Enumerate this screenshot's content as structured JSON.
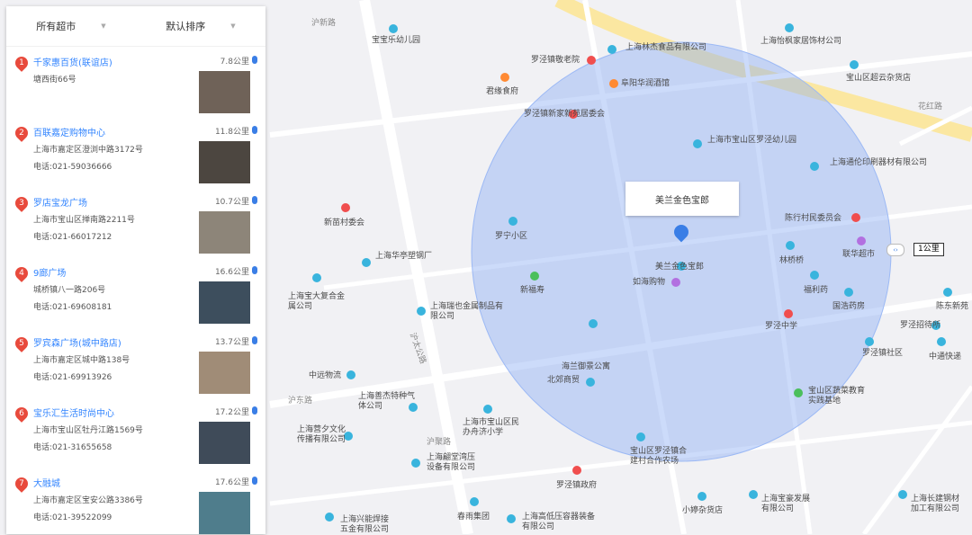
{
  "filters": {
    "category": "所有超市",
    "sort": "默认排序"
  },
  "stores": [
    {
      "num": "1",
      "name": "千家惠百货(联谊店)",
      "address": "塘西街66号",
      "phone": "",
      "distance": "7.8公里",
      "thumb": "#6f6258"
    },
    {
      "num": "2",
      "name": "百联嘉定购物中心",
      "address": "上海市嘉定区澄浏中路3172号",
      "phone": "电话:021-59036666",
      "distance": "11.8公里",
      "thumb": "#4c4640"
    },
    {
      "num": "3",
      "name": "罗店宝龙广场",
      "address": "上海市宝山区掸南路2211号",
      "phone": "电话:021-66017212",
      "distance": "10.7公里",
      "thumb": "#8d8579"
    },
    {
      "num": "4",
      "name": "9廊广场",
      "address": "城桥镇八一路206号",
      "phone": "电话:021-69608181",
      "distance": "16.6公里",
      "thumb": "#3d4e5d"
    },
    {
      "num": "5",
      "name": "罗宾森广场(城中路店)",
      "address": "上海市嘉定区城中路138号",
      "phone": "电话:021-69913926",
      "distance": "13.7公里",
      "thumb": "#a08c77"
    },
    {
      "num": "6",
      "name": "宝乐汇生活时尚中心",
      "address": "上海市宝山区牡丹江路1569号",
      "phone": "电话:021-31655658",
      "distance": "17.2公里",
      "thumb": "#3f4b59"
    },
    {
      "num": "7",
      "name": "大融城",
      "address": "上海市嘉定区宝安公路3386号",
      "phone": "电话:021-39522099",
      "distance": "17.6公里",
      "thumb": "#4f7d8c"
    }
  ],
  "map": {
    "center_label": "美兰金色宝郎",
    "radius_label": "1公里",
    "radius_handle": "‹›",
    "pois": [
      {
        "text": "沪新路",
        "type": "road"
      },
      {
        "text": "宝宝乐幼儿园",
        "type": "blue"
      },
      {
        "text": "罗泾镇敬老院",
        "type": "red"
      },
      {
        "text": "上海林杰食品有限公司",
        "type": "blue"
      },
      {
        "text": "上海怡枫家居饰材公司",
        "type": "blue"
      },
      {
        "text": "宝山区超云杂货店",
        "type": "blue"
      },
      {
        "text": "君缘食府",
        "type": "orange"
      },
      {
        "text": "阜阳华润酒馆",
        "type": "orange"
      },
      {
        "text": "罗泾镇新家新苑居委会",
        "type": "red"
      },
      {
        "text": "上海市宝山区罗泾幼儿园",
        "type": "blue"
      },
      {
        "text": "上海通伦印刷器材有限公司",
        "type": "blue"
      },
      {
        "text": "花红路",
        "type": "road"
      },
      {
        "text": "新苗村委会",
        "type": "red"
      },
      {
        "text": "陈行村民委员会",
        "type": "red"
      },
      {
        "text": "联华超市",
        "type": "purple"
      },
      {
        "text": "上海华亭塑钢厂",
        "type": "blue"
      },
      {
        "text": "罗宁小区",
        "type": "blue"
      },
      {
        "text": "新福寿",
        "type": "green"
      },
      {
        "text": "美兰金色宝郎",
        "type": "blue"
      },
      {
        "text": "如海购物",
        "type": "purple"
      },
      {
        "text": "林桥桥",
        "type": "blue"
      },
      {
        "text": "福利药",
        "type": "blue"
      },
      {
        "text": "国浩药房",
        "type": "blue"
      },
      {
        "text": "陈东新苑",
        "type": "blue"
      },
      {
        "text": "罗泾招待所",
        "type": "blue"
      },
      {
        "text": "上海宝大复合金属公司",
        "type": "blue"
      },
      {
        "text": "上海瑞也金属制品有限公司",
        "type": "blue"
      },
      {
        "text": "海兰御景公寓",
        "type": "blue"
      },
      {
        "text": "罗泾中学",
        "type": "blue"
      },
      {
        "text": "罗泾镇社区",
        "type": "blue"
      },
      {
        "text": "中通快递",
        "type": "blue"
      },
      {
        "text": "中远物流",
        "type": "blue"
      },
      {
        "text": "北郊商贸",
        "type": "blue"
      },
      {
        "text": "宝山区蔬菜教育实践基地",
        "type": "green"
      },
      {
        "text": "上海善杰特种气体公司",
        "type": "blue"
      },
      {
        "text": "上海市宝山区民办舟济小学",
        "type": "blue"
      },
      {
        "text": "宝山区罗泾镇合建村合作农场",
        "type": "blue"
      },
      {
        "text": "罗泾镇政府",
        "type": "red"
      },
      {
        "text": "上海营夕文化传播有限公司",
        "type": "blue"
      },
      {
        "text": "上海翩堂湾压设备有限公司",
        "type": "blue"
      },
      {
        "text": "上海宝豪发展有限公司",
        "type": "blue"
      },
      {
        "text": "上海长建钢材加工有限公司",
        "type": "blue"
      },
      {
        "text": "小婷杂货店",
        "type": "blue"
      },
      {
        "text": "上海兴能焊接五金有限公司",
        "type": "blue"
      },
      {
        "text": "上海高低压容器装备有限公司",
        "type": "blue"
      },
      {
        "text": "春雨集团",
        "type": "blue"
      },
      {
        "text": "沪太公路",
        "type": "road"
      },
      {
        "text": "沪东路",
        "type": "road"
      },
      {
        "text": "沪聚路",
        "type": "road"
      }
    ]
  }
}
